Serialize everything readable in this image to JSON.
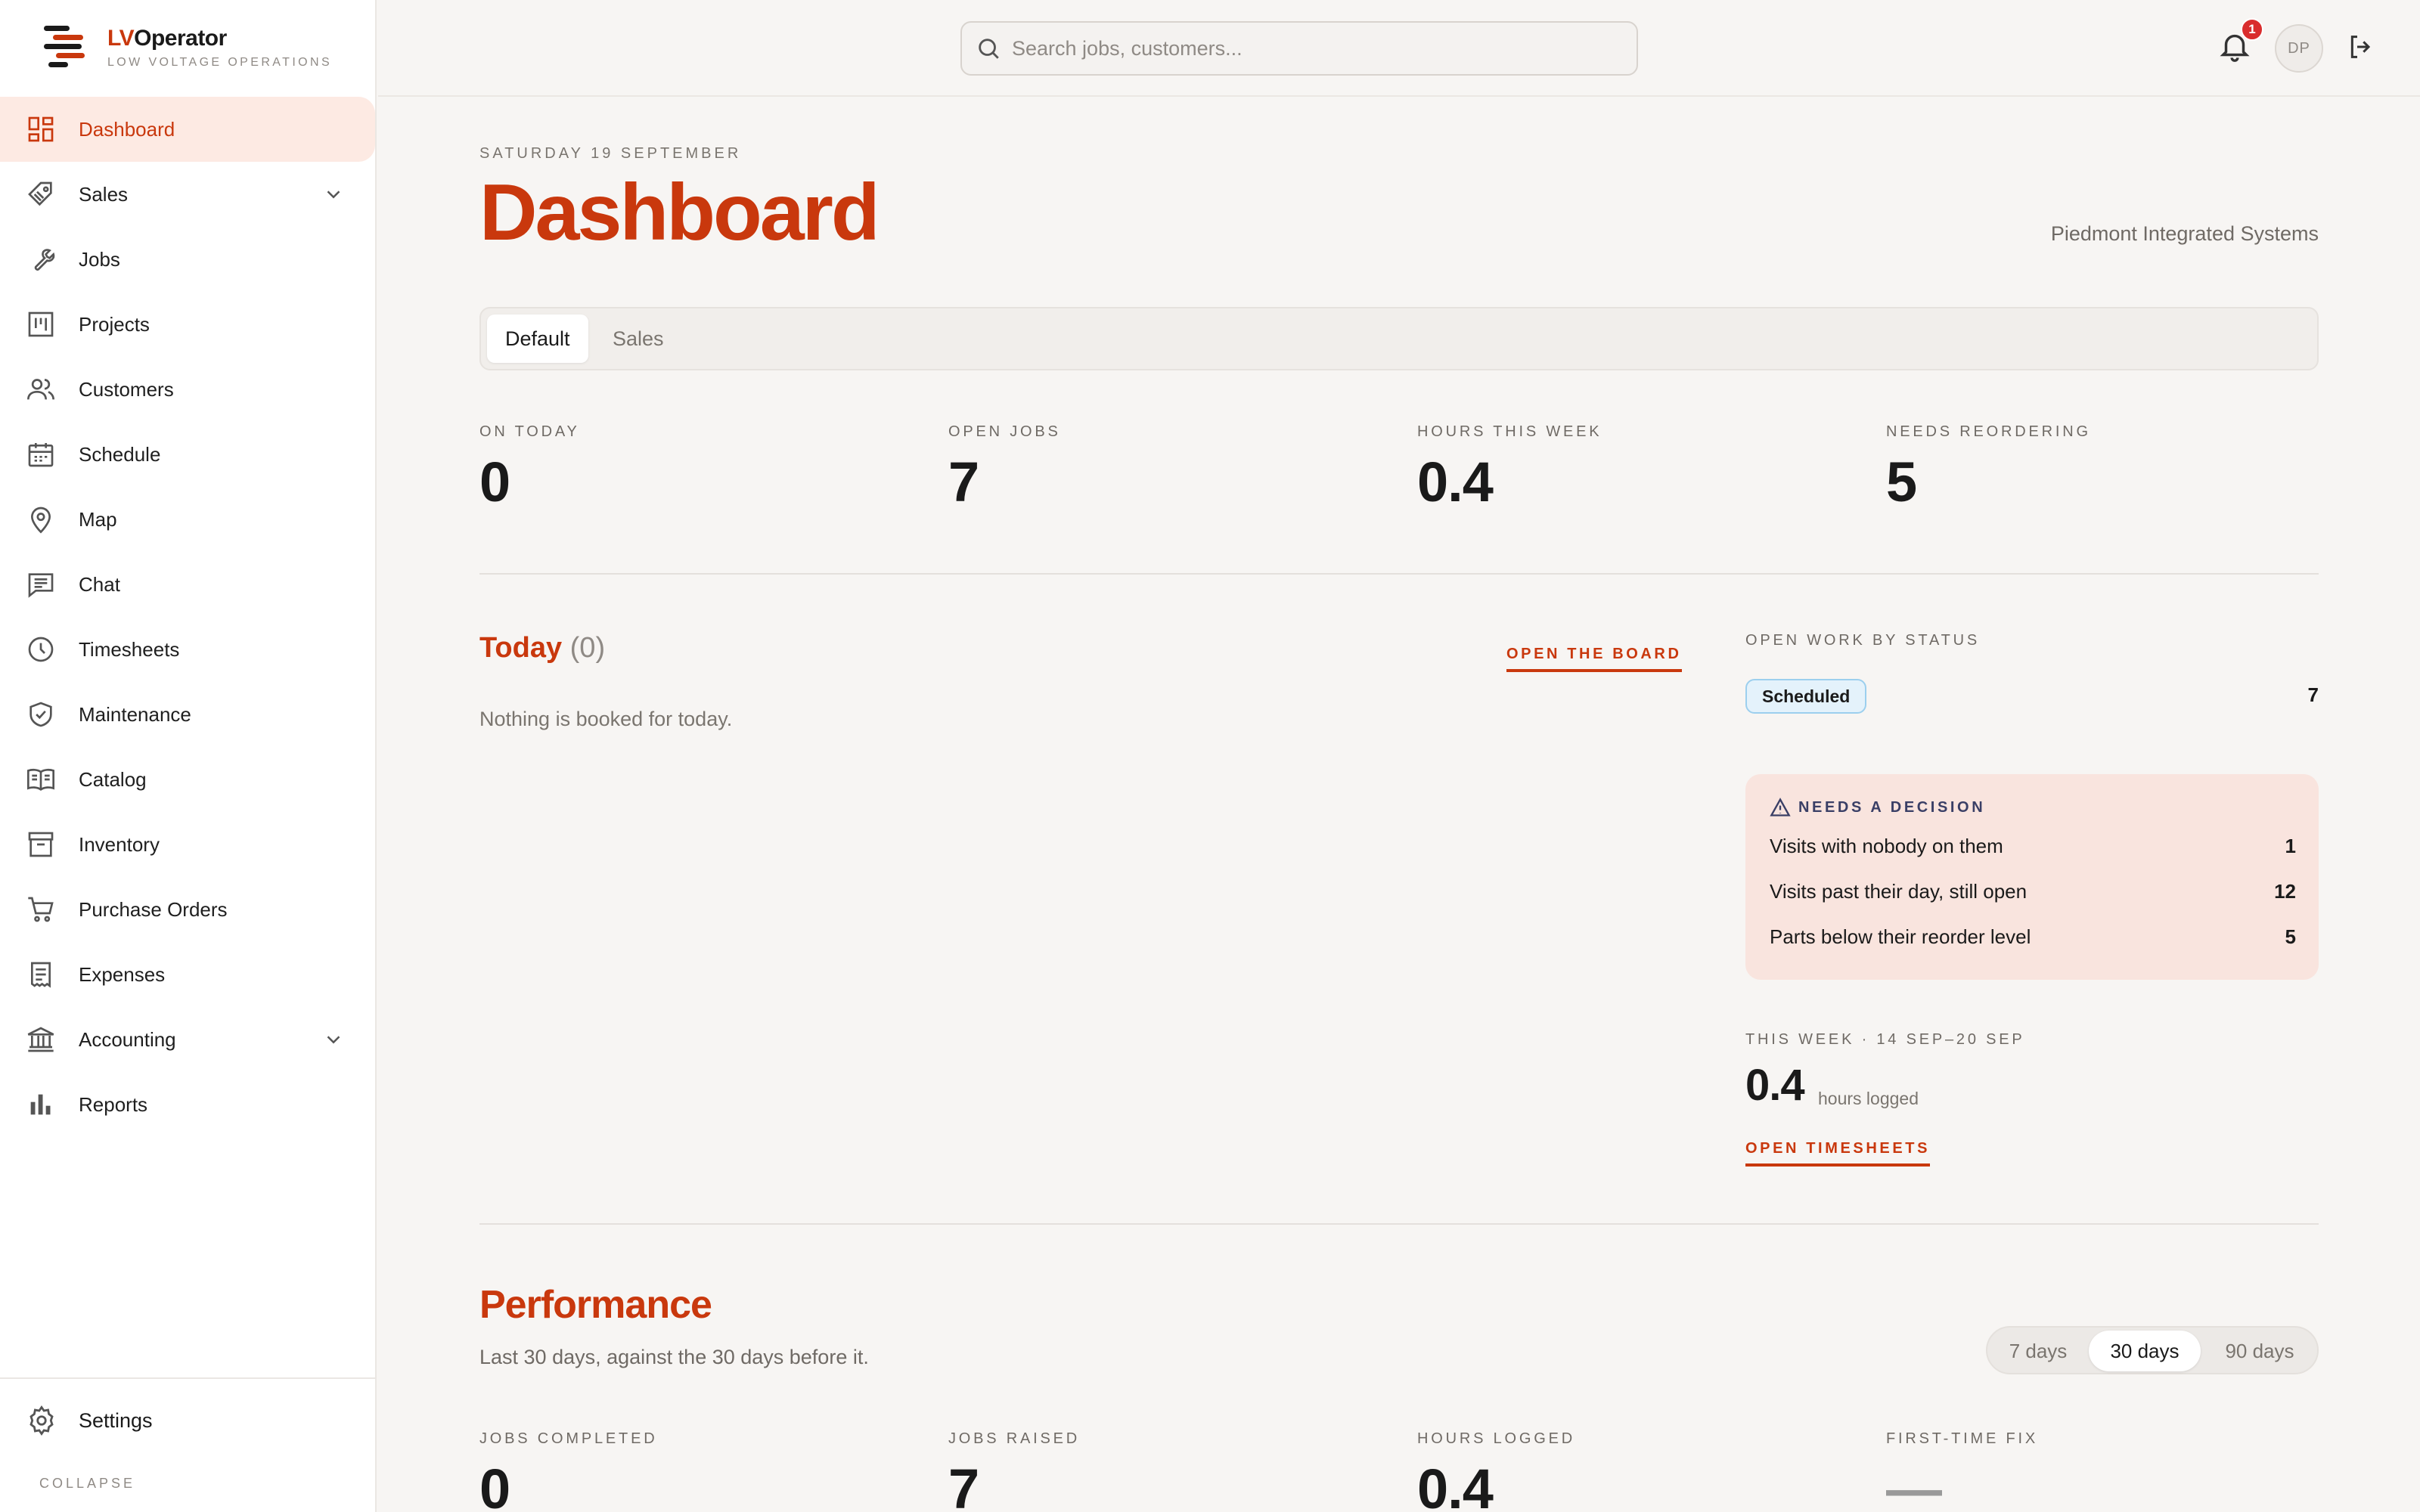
{
  "brand": {
    "name_accent": "LV",
    "name_rest": "Operator",
    "tagline": "LOW VOLTAGE OPERATIONS"
  },
  "sidebar": {
    "items": [
      {
        "label": "Dashboard",
        "icon": "dashboard-icon",
        "active": true
      },
      {
        "label": "Sales",
        "icon": "tag-icon",
        "expandable": true
      },
      {
        "label": "Jobs",
        "icon": "wrench-icon"
      },
      {
        "label": "Projects",
        "icon": "kanban-icon"
      },
      {
        "label": "Customers",
        "icon": "users-icon"
      },
      {
        "label": "Schedule",
        "icon": "calendar-icon"
      },
      {
        "label": "Map",
        "icon": "map-pin-icon"
      },
      {
        "label": "Chat",
        "icon": "chat-icon"
      },
      {
        "label": "Timesheets",
        "icon": "clock-icon"
      },
      {
        "label": "Maintenance",
        "icon": "shield-check-icon"
      },
      {
        "label": "Catalog",
        "icon": "book-icon"
      },
      {
        "label": "Inventory",
        "icon": "archive-box-icon"
      },
      {
        "label": "Purchase Orders",
        "icon": "cart-icon"
      },
      {
        "label": "Expenses",
        "icon": "receipt-icon"
      },
      {
        "label": "Accounting",
        "icon": "bank-icon",
        "expandable": true
      },
      {
        "label": "Reports",
        "icon": "bar-chart-icon"
      }
    ],
    "settings_label": "Settings",
    "collapse_label": "COLLAPSE"
  },
  "topbar": {
    "search_placeholder": "Search jobs, customers...",
    "notification_count": "1",
    "avatar_initials": "DP"
  },
  "header": {
    "date": "SATURDAY 19 SEPTEMBER",
    "title": "Dashboard",
    "company": "Piedmont Integrated Systems"
  },
  "tabs": [
    {
      "label": "Default",
      "active": true
    },
    {
      "label": "Sales",
      "active": false
    }
  ],
  "kpis": [
    {
      "label": "ON TODAY",
      "value": "0"
    },
    {
      "label": "OPEN JOBS",
      "value": "7"
    },
    {
      "label": "HOURS THIS WEEK",
      "value": "0.4"
    },
    {
      "label": "NEEDS REORDERING",
      "value": "5"
    }
  ],
  "today": {
    "title": "Today",
    "count": "(0)",
    "link": "OPEN THE BOARD",
    "empty": "Nothing is booked for today."
  },
  "status": {
    "label": "OPEN WORK BY STATUS",
    "items": [
      {
        "name": "Scheduled",
        "count": "7"
      }
    ]
  },
  "decision": {
    "title": "NEEDS A DECISION",
    "rows": [
      {
        "label": "Visits with nobody on them",
        "value": "1"
      },
      {
        "label": "Visits past their day, still open",
        "value": "12"
      },
      {
        "label": "Parts below their reorder level",
        "value": "5"
      }
    ]
  },
  "week": {
    "label": "THIS WEEK · 14 SEP–20 SEP",
    "value": "0.4",
    "unit": "hours logged",
    "link": "OPEN TIMESHEETS"
  },
  "performance": {
    "title": "Performance",
    "subtitle": "Last 30 days, against the 30 days before it.",
    "ranges": [
      {
        "label": "7 days",
        "active": false
      },
      {
        "label": "30 days",
        "active": true
      },
      {
        "label": "90 days",
        "active": false
      }
    ],
    "kpis": [
      {
        "label": "JOBS COMPLETED",
        "value": "0"
      },
      {
        "label": "JOBS RAISED",
        "value": "7"
      },
      {
        "label": "HOURS LOGGED",
        "value": "0.4"
      },
      {
        "label": "FIRST-TIME FIX",
        "value": "—"
      }
    ]
  },
  "colors": {
    "accent": "#c9380d",
    "active_bg": "#fdeae3",
    "decision_bg": "#f9e4de",
    "status_pill": "#e4f2fb",
    "badge": "#d92d2d"
  }
}
